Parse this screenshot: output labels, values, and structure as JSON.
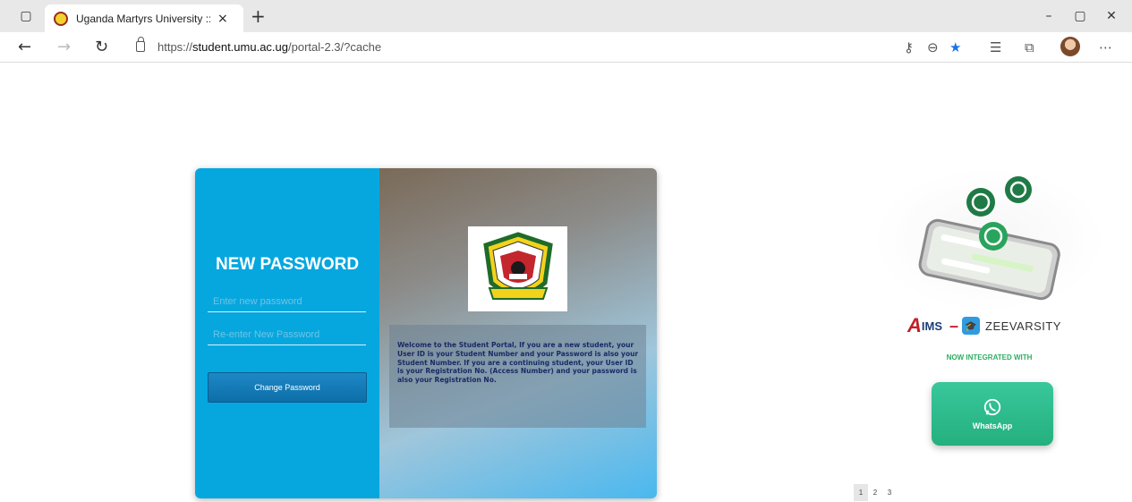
{
  "browser": {
    "tab_title": "Uganda Martyrs University :: Stuc",
    "tab_close": "×",
    "new_tab": "+",
    "url_prefix": "https://",
    "url_host": "student.umu.ac.ug",
    "url_path": "/portal-2.3/?cache",
    "window_controls": [
      "–",
      "▢",
      "✕"
    ]
  },
  "login": {
    "heading": "NEW PASSWORD",
    "new_password_placeholder": "Enter new password",
    "reenter_placeholder": "Re-enter New Password",
    "submit_label": "Change Password",
    "welcome_text": "Welcome to the Student Portal, If you are a new student, your User ID is your Student Number and your Password is also your Student Number. If you are a continuing student, your User ID is your Registration No. (Access Number) and your password is also your Registration No."
  },
  "promo": {
    "aims": "IMS",
    "dash": "–",
    "zeevarsity": "ZEEVARSITY",
    "integrated": "NOW INTEGRATED WITH",
    "whatsapp": "WhatsApp"
  },
  "pager": {
    "pages": [
      "1",
      "2",
      "3"
    ],
    "active": "1"
  },
  "colors": {
    "card_left": "#06a7df",
    "button": "#0d6ea8",
    "whatsapp": "#24b07e",
    "integrated_text": "#2eae61"
  }
}
